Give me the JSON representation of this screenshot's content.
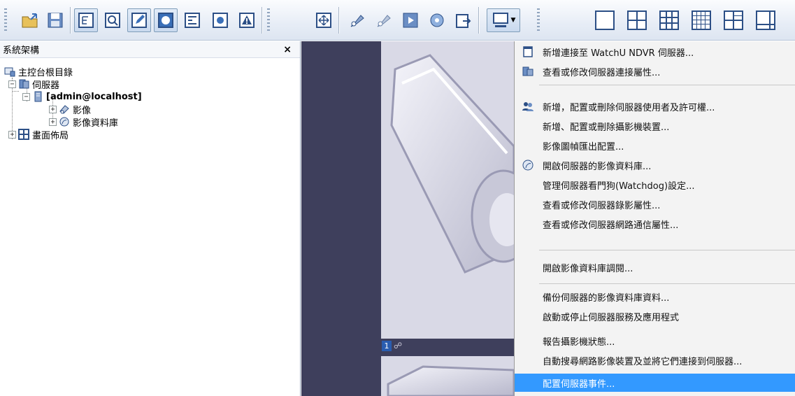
{
  "toolbar": {
    "buttons_left": [
      {
        "icon": "open-folder-icon"
      },
      {
        "icon": "save-icon"
      },
      {
        "icon": "tree-view-icon"
      },
      {
        "icon": "preview-icon"
      },
      {
        "icon": "edit-icon"
      },
      {
        "icon": "record-icon"
      },
      {
        "icon": "network-icon"
      },
      {
        "icon": "camera-icon"
      },
      {
        "icon": "alert-icon"
      }
    ],
    "buttons_mid": [
      {
        "icon": "fullscreen-icon"
      },
      {
        "icon": "ptz-icon"
      },
      {
        "icon": "ptz2-icon"
      },
      {
        "icon": "playback-icon"
      },
      {
        "icon": "database-icon"
      },
      {
        "icon": "export-icon"
      }
    ],
    "server_dropdown_icon": "server-monitor-icon",
    "layout_buttons": [
      {
        "icon": "layout-1x1-icon"
      },
      {
        "icon": "layout-2x2-icon"
      },
      {
        "icon": "layout-3x3-icon"
      },
      {
        "icon": "layout-4x4-icon"
      },
      {
        "icon": "layout-2x3-icon"
      },
      {
        "icon": "layout-custom-icon"
      }
    ]
  },
  "panel": {
    "title": "系統架構",
    "close": "×"
  },
  "tree": {
    "root": "主控台根目錄",
    "servers": "伺服器",
    "server_node": "[admin@localhost]",
    "video": "影像",
    "video_db": "影像資料庫",
    "layouts": "畫面佈局",
    "expand_minus": "−",
    "expand_plus": "+"
  },
  "view": {
    "number": "1",
    "pin": "☍"
  },
  "menu": {
    "items": [
      {
        "label": "新增連接至 WatchU NDVR 伺服器..."
      },
      {
        "label": "查看或修改伺服器連接屬性..."
      },
      {
        "label": "新增，配置或刪除伺服器使用者及許可權..."
      },
      {
        "label": "新增、配置或刪除攝影機裝置..."
      },
      {
        "label": "影像圖幀匯出配置..."
      },
      {
        "label": "開啟伺服器的影像資料庫..."
      },
      {
        "label": "管理伺服器看門狗(Watchdog)設定..."
      },
      {
        "label": "查看或修改伺服器錄影屬性..."
      },
      {
        "label": "查看或修改伺服器網路通信屬性..."
      },
      {
        "label": "開啟影像資料庫調閱..."
      },
      {
        "label": "備份伺服器的影像資料庫資料..."
      },
      {
        "label": "啟動或停止伺服器服務及應用程式"
      },
      {
        "label": "報告攝影機狀態..."
      },
      {
        "label": "自動搜尋網路影像裝置及並將它們連接到伺服器..."
      },
      {
        "label": "配置伺服器事件..."
      }
    ]
  },
  "colors": {
    "highlight": "#3399ff",
    "dark_bg": "#3e3f5c",
    "accent": "#2c4f86"
  }
}
